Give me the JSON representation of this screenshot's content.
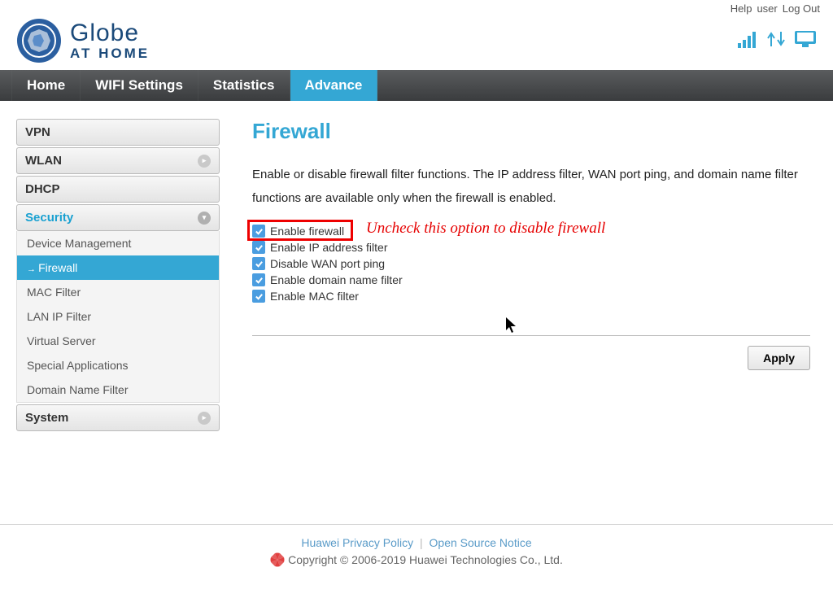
{
  "top": {
    "help": "Help",
    "user": "user",
    "logout": "Log Out"
  },
  "brand": {
    "name": "Globe",
    "sub": "AT HOME"
  },
  "nav": [
    "Home",
    "WIFI Settings",
    "Statistics",
    "Advance"
  ],
  "nav_active": 3,
  "sidebar": {
    "groups": [
      {
        "label": "VPN",
        "expandable": false
      },
      {
        "label": "WLAN",
        "expandable": true
      },
      {
        "label": "DHCP",
        "expandable": false
      },
      {
        "label": "Security",
        "expandable": true,
        "active": true,
        "items": [
          "Device Management",
          "Firewall",
          "MAC Filter",
          "LAN IP Filter",
          "Virtual Server",
          "Special Applications",
          "Domain Name Filter"
        ],
        "active_item": 1
      },
      {
        "label": "System",
        "expandable": true
      }
    ]
  },
  "page": {
    "title": "Firewall",
    "desc": "Enable or disable firewall filter functions. The IP address filter, WAN port ping, and domain name filter functions are available only when the firewall is enabled.",
    "checks": [
      "Enable firewall",
      "Enable IP address filter",
      "Disable WAN port ping",
      "Enable domain name filter",
      "Enable MAC filter"
    ],
    "annotation": "Uncheck this option to disable firewall",
    "apply": "Apply"
  },
  "footer": {
    "privacy": "Huawei Privacy Policy",
    "oss": "Open Source Notice",
    "copyright": "Copyright © 2006-2019 Huawei Technologies Co., Ltd."
  }
}
